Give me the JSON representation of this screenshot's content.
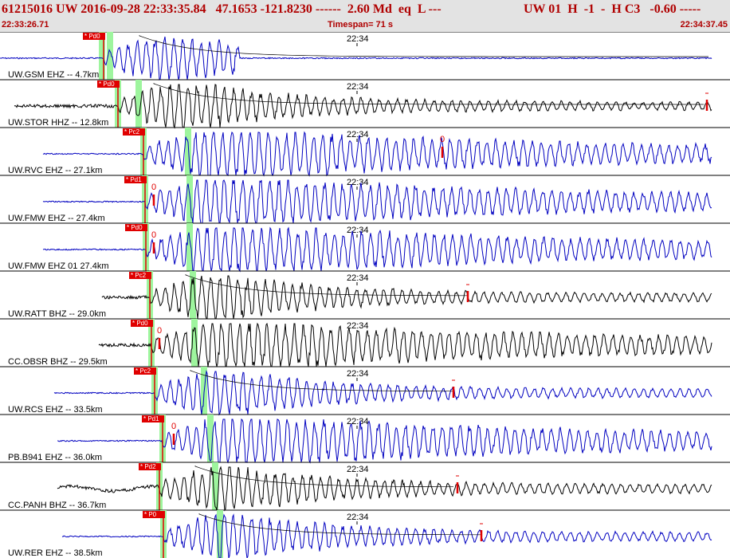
{
  "header": {
    "title": "61215016 UW 2016-09-28 22:33:35.84   47.1653 -121.8230 ------  2.60 Md  eq  L ---",
    "right": "UW 01  H  -1  -  H C3   -0.60 -----",
    "start_time": "22:33:26.71",
    "timespan": "Timespan=  71 s",
    "end_time": "22:34:37.45"
  },
  "colors": {
    "blue": "#0000c0",
    "black": "#000000",
    "red": "#e00000",
    "green": "#9ef59e",
    "pick_bg": "#e00000",
    "header_bg": "#e3e3e3"
  },
  "minute_tick": "22:34",
  "traces": [
    {
      "label": "UW.GSM EHZ -- 4.7km",
      "color": "blue",
      "pick": "* Pd0",
      "zero": ""
    },
    {
      "label": "UW.STOR HHZ -- 12.8km",
      "color": "black",
      "pick": "* Pd0",
      "zero": ""
    },
    {
      "label": "UW.RVC EHZ -- 27.1km",
      "color": "blue",
      "pick": "* Pc2",
      "zero": "0"
    },
    {
      "label": "UW.FMW EHZ -- 27.4km",
      "color": "blue",
      "pick": "* Pd1",
      "zero": "0"
    },
    {
      "label": "UW.FMW EHZ 01 27.4km",
      "color": "blue",
      "pick": "* Pd0",
      "zero": "0"
    },
    {
      "label": "UW.RATT BHZ -- 29.0km",
      "color": "black",
      "pick": "* Pc2",
      "zero": ""
    },
    {
      "label": "CC.OBSR BHZ -- 29.5km",
      "color": "black",
      "pick": "* Pd0",
      "zero": "0"
    },
    {
      "label": "UW.RCS EHZ -- 33.5km",
      "color": "blue",
      "pick": "* Pc2",
      "zero": ""
    },
    {
      "label": "PB.B941 EHZ -- 36.0km",
      "color": "blue",
      "pick": "* Pd1",
      "zero": "0"
    },
    {
      "label": "CC.PANH BHZ -- 36.7km",
      "color": "black",
      "pick": "* Pd2",
      "zero": ""
    },
    {
      "label": "UW.RER EHZ -- 38.5km",
      "color": "blue",
      "pick": "* P0",
      "zero": ""
    }
  ]
}
